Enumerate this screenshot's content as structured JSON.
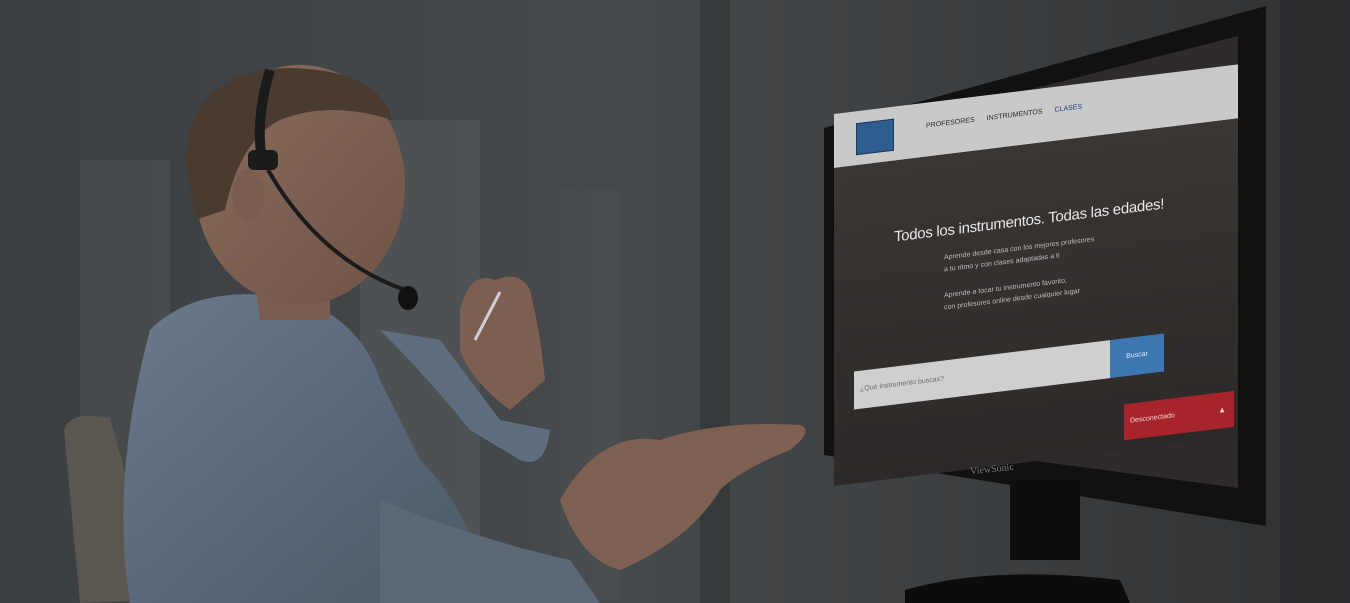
{
  "photo": {
    "monitor_brand": "ViewSonic"
  },
  "website": {
    "nav": [
      "PROFESORES",
      "INSTRUMENTOS",
      "CLASES"
    ],
    "hero": {
      "title": "Todos los instrumentos. Todas las edades!",
      "lines": [
        "Aprende desde casa con los mejores profesores",
        "a tu ritmo y con clases adaptadas a ti",
        "Aprende a tocar tu instrumento favorito,",
        "con profesores online desde cualquier lugar"
      ]
    },
    "search": {
      "placeholder": "¿Qué instrumento buscas?",
      "button_label": "Buscar"
    },
    "chat": {
      "status_label": "Desconectado",
      "toggle_icon": "chevron-up-icon"
    }
  },
  "colors": {
    "search_button": "#3e76b2",
    "chat_badge": "#a8242b"
  }
}
